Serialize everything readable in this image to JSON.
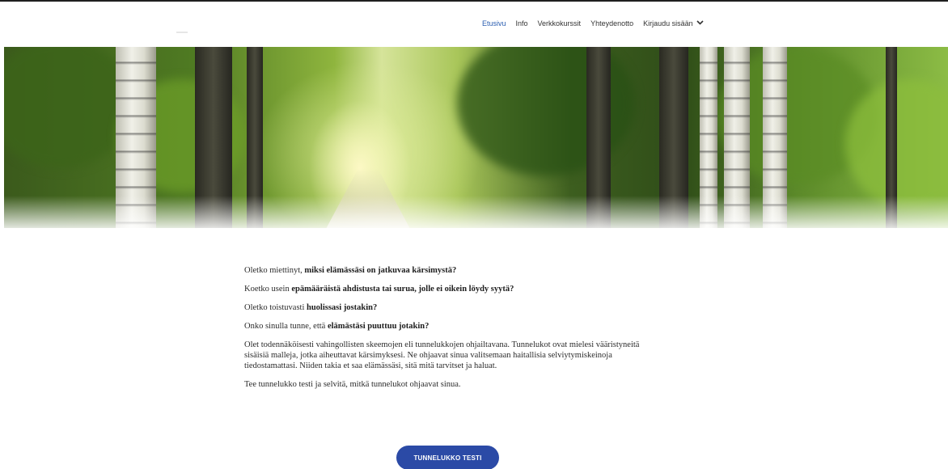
{
  "header": {
    "nav": [
      {
        "label": "Etusivu",
        "active": true
      },
      {
        "label": "Info",
        "active": false
      },
      {
        "label": "Verkkokurssit",
        "active": false
      },
      {
        "label": "Yhteydenotto",
        "active": false
      }
    ],
    "login_label": "Kirjaudu sisään",
    "login_icon": "chevron-down-icon",
    "active_color": "#2a5db0"
  },
  "hero": {
    "image": "forest-path-with-birch-trees"
  },
  "content": {
    "p1": {
      "pre": "Oletko miettinyt, ",
      "bold": "miksi elämässäsi on jatkuvaa kärsimystä?"
    },
    "p2": {
      "pre": "Koetko usein ",
      "bold": "epämääräistä ahdistusta tai surua, jolle ei oikein löydy syytä?"
    },
    "p3": {
      "pre": "Oletko toistuvasti ",
      "bold": "huolissasi jostakin?"
    },
    "p4": {
      "pre": "Onko sinulla tunne, että ",
      "bold": "elämästäsi puuttuu jotakin?"
    },
    "p5": "Olet todennäköisesti vahingollisten skeemojen eli tunnelukkojen ohjailtavana. Tunnelukot ovat mielesi vääristyneitä sisäisiä malleja, jotka aiheuttavat kärsimyksesi. Ne ohjaavat sinua valitsemaan haitallisia selviytymiskeinoja tiedostamattasi. Niiden takia et saa elämässäsi, sitä mitä tarvitset ja haluat.",
    "p6": "Tee tunnelukko testi ja selvitä, mitkä tunnelukot ohjaavat sinua."
  },
  "cta": {
    "label": "TUNNELUKKO TESTI",
    "color": "#2b4aa6"
  }
}
